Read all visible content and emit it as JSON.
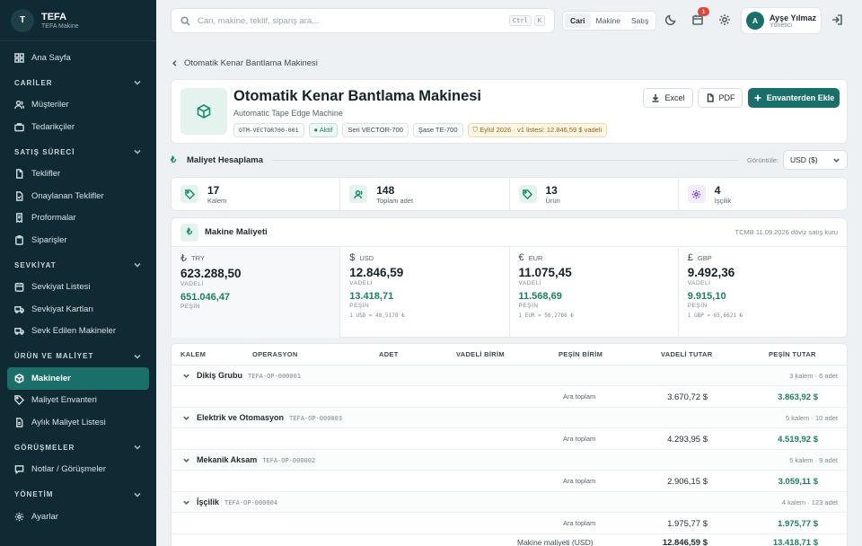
{
  "brand": {
    "logo_letter": "T",
    "name": "TEFA",
    "sub": "TEFA Makine"
  },
  "sidebar": {
    "home": "Ana Sayfa",
    "sections": [
      {
        "title": "CARİLER",
        "items": [
          "Müşteriler",
          "Tedarikçiler"
        ]
      },
      {
        "title": "SATIŞ SÜRECİ",
        "items": [
          "Teklifler",
          "Onaylanan Teklifler",
          "Proformalar",
          "Siparişler"
        ]
      },
      {
        "title": "SEVKİYAT",
        "items": [
          "Sevkiyat Listesi",
          "Sevkiyat Kartları",
          "Sevk Edilen Makineler"
        ]
      },
      {
        "title": "ÜRÜN VE MALİYET",
        "items": [
          "Makineler",
          "Maliyet Envanteri",
          "Aylık Maliyet Listesi"
        ]
      },
      {
        "title": "GÖRÜŞMELER",
        "items": [
          "Notlar / Görüşmeler"
        ]
      },
      {
        "title": "YÖNETİM",
        "items": [
          "Ayarlar"
        ]
      }
    ]
  },
  "topbar": {
    "search_placeholder": "Cari, makine, teklif, sipariş ara...",
    "kbd1": "Ctrl",
    "kbd2": "K",
    "seg": [
      "Cari",
      "Makine",
      "Satış"
    ],
    "notif_count": "1",
    "user_initial": "A",
    "user_name": "Ayşe Yılmaz",
    "user_role": "Yönetici"
  },
  "page": {
    "breadcrumb": "Otomatik Kenar Bantlama Makinesi",
    "title": "Otomatik Kenar Bantlama Makinesi",
    "subtitle": "Automatic Tape Edge Machine",
    "tags": {
      "code": "OTM-VECTOR700-001",
      "status": "Aktif",
      "series": "Seri VECTOR-700",
      "chassis": "Şase TE-700",
      "price_list": "Eylül 2026 · v1 listesi: 12.846,59 $ vadeli"
    },
    "btn_excel": "Excel",
    "btn_pdf": "PDF",
    "btn_add": "Envanterden Ekle"
  },
  "cost_section": {
    "title": "Maliyet Hesaplama",
    "view_label": "Görüntüle:",
    "view_value": "USD ($)"
  },
  "stats": [
    {
      "value": "17",
      "label": "Kalem"
    },
    {
      "value": "148",
      "label": "Toplam adet"
    },
    {
      "value": "13",
      "label": "Ürün"
    },
    {
      "value": "4",
      "label": "İşçilik"
    }
  ],
  "machine_cost": {
    "symbol": "₺",
    "title": "Makine Maliyeti",
    "note": "TCMB 11.09.2026 döviz satış kuru",
    "currencies": [
      {
        "symbol": "₺",
        "code": "TRY",
        "vadeli": "623.288,50",
        "vadeli_label": "VADELİ",
        "pesin": "651.046,47",
        "pesin_label": "PEŞİN",
        "rate": ""
      },
      {
        "symbol": "$",
        "code": "USD",
        "vadeli": "12.846,59",
        "vadeli_label": "VADELİ",
        "pesin": "13.418,71",
        "pesin_label": "PEŞİN",
        "rate": "1 USD = 48,5178 ₺"
      },
      {
        "symbol": "€",
        "code": "EUR",
        "vadeli": "11.075,45",
        "vadeli_label": "VADELİ",
        "pesin": "11.568,69",
        "pesin_label": "PEŞİN",
        "rate": "1 EUR = 56,2786 ₺"
      },
      {
        "symbol": "£",
        "code": "GBP",
        "vadeli": "9.492,36",
        "vadeli_label": "VADELİ",
        "pesin": "9.915,10",
        "pesin_label": "PEŞİN",
        "rate": "1 GBP = 65,6621 ₺"
      }
    ]
  },
  "table": {
    "headers": [
      "KALEM",
      "OPERASYON",
      "ADET",
      "VADELİ BİRİM",
      "PEŞİN BİRİM",
      "VADELİ TUTAR",
      "PEŞİN TUTAR"
    ],
    "subtotal_label": "Ara toplam",
    "groups": [
      {
        "name": "Dikiş Grubu",
        "code": "TEFA-OP-000001",
        "meta": "3 kalem · 6 adet",
        "vadeli": "3.670,72 $",
        "pesin": "3.863,92 $"
      },
      {
        "name": "Elektrik ve Otomasyon",
        "code": "TEFA-OP-000003",
        "meta": "5 kalem · 10 adet",
        "vadeli": "4.293,95 $",
        "pesin": "4.519,92 $"
      },
      {
        "name": "Mekanik Aksam",
        "code": "TEFA-OP-000002",
        "meta": "5 kalem · 9 adet",
        "vadeli": "2.906,15 $",
        "pesin": "3.059,11 $"
      },
      {
        "name": "İşçilik",
        "code": "TEFA-OP-000004",
        "meta": "4 kalem · 123 adet",
        "vadeli": "1.975,77 $",
        "pesin": "1.975,77 $"
      }
    ],
    "total_label": "Makine maliyeti (USD)",
    "total_vadeli": "12.846,59 $",
    "total_pesin": "13.418,71 $"
  }
}
